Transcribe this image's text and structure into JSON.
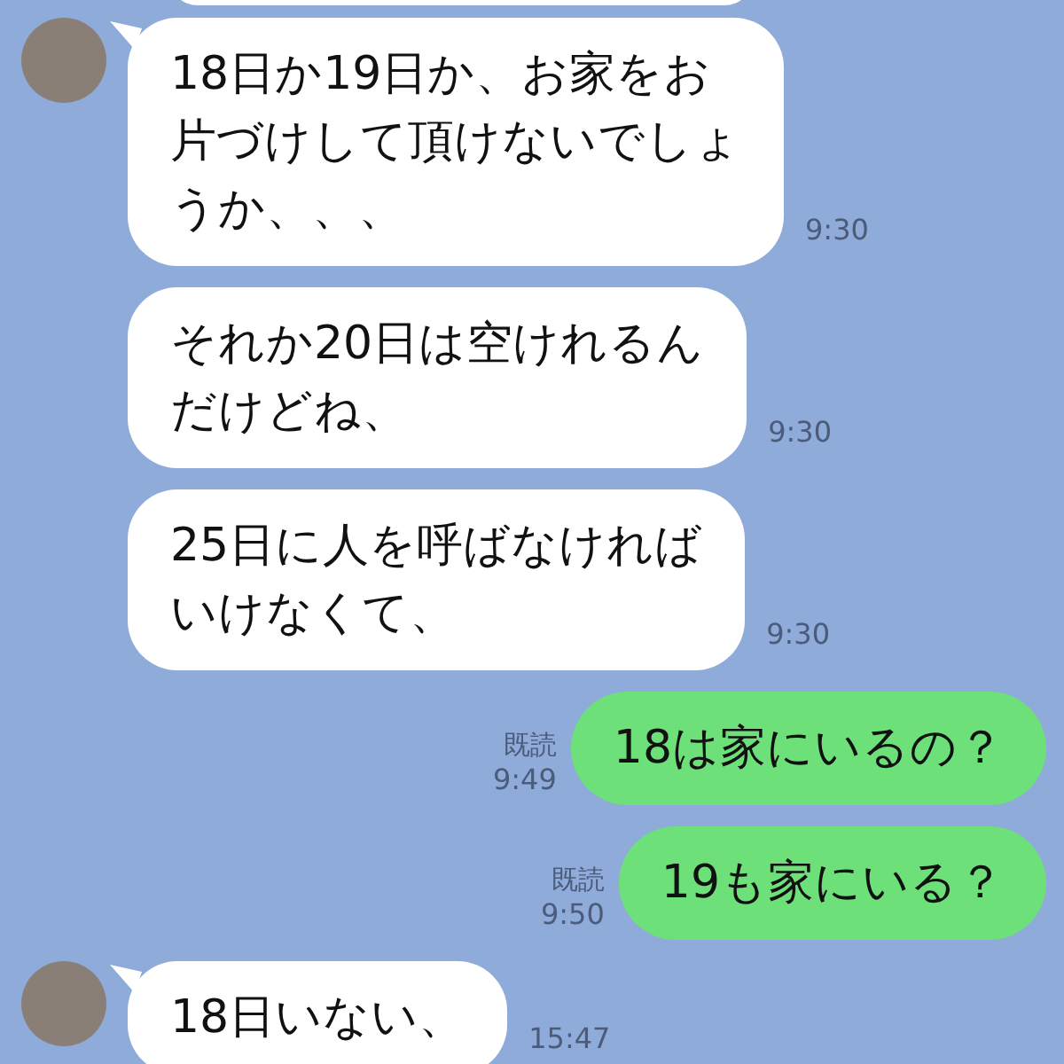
{
  "messages": [
    {
      "kind": "received",
      "avatar": true,
      "tail": true,
      "lines": [
        "18日か19日か、お家をお",
        "片づけして頂けないでしょ",
        "うか、、、"
      ],
      "time": "9:30"
    },
    {
      "kind": "received",
      "avatar": false,
      "tail": false,
      "lines": [
        "それか20日は空けれるん",
        "だけどね、"
      ],
      "time": "9:30"
    },
    {
      "kind": "received",
      "avatar": false,
      "tail": false,
      "lines": [
        "25日に人を呼ばなければ",
        "いけなくて、"
      ],
      "time": "9:30"
    },
    {
      "kind": "sent",
      "read": "既読",
      "tail": false,
      "lines": [
        "18は家にいるの？"
      ],
      "time": "9:49"
    },
    {
      "kind": "sent",
      "read": "既読",
      "tail": false,
      "lines": [
        "19も家にいる？"
      ],
      "time": "9:50"
    },
    {
      "kind": "received",
      "avatar": true,
      "tail": true,
      "lines": [
        "18日いない、"
      ],
      "time": "15:47"
    }
  ]
}
